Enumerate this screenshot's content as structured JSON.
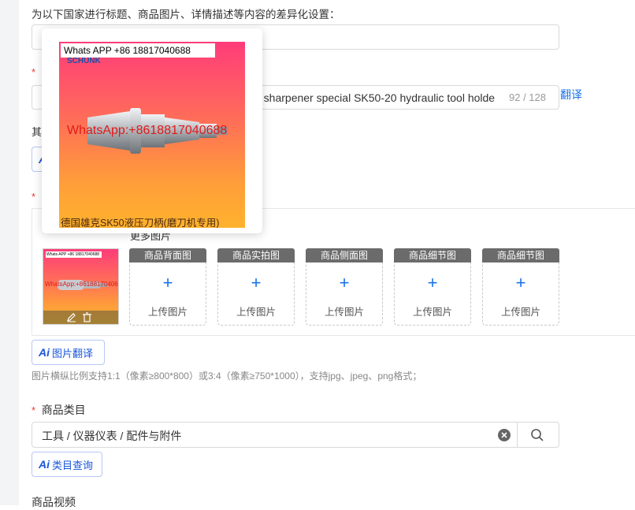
{
  "section_heading": "为以下国家进行标题、商品图片、详情描述等内容的差异化设置：",
  "title_field": {
    "visible_text": "ife sharpener special SK50-20 hydraulic tool holde",
    "counter": "92 / 128",
    "translate_link": "翻译"
  },
  "other_label_partial": "其",
  "ai_partial": "A",
  "image_section": {
    "tab_partial": "更多图片",
    "slots": [
      {
        "caption": "商品背面图",
        "upload": "上传图片"
      },
      {
        "caption": "商品实拍图",
        "upload": "上传图片"
      },
      {
        "caption": "商品侧面图",
        "upload": "上传图片"
      },
      {
        "caption": "商品细节图",
        "upload": "上传图片"
      },
      {
        "caption": "商品细节图",
        "upload": "上传图片"
      }
    ],
    "translate_button": "图片翻译",
    "hint": "图片横纵比例支持1:1（像素≥800*800）或3:4（像素≥750*1000），支持jpg、jpeg、png格式；"
  },
  "category": {
    "label": "商品类目",
    "value": "工具 / 仪器仪表 / 配件与附件",
    "lookup_button": "类目查询"
  },
  "video_label": "商品视频",
  "preview": {
    "contact_banner": "Whats APP +86 18817040688",
    "brand": "SCHUNK",
    "watermark": "WhatsApp:+8618817040688",
    "caption": "德国雄克SK50液压刀柄(磨刀机专用)"
  },
  "thumbnail": {
    "contact_banner": "Whats APP +86 18817040688",
    "watermark": "WhatsApp:+8618817040688"
  },
  "colors": {
    "accent": "#1a73e8",
    "required": "#e53935",
    "caption_bg": "#6b6b6b"
  }
}
